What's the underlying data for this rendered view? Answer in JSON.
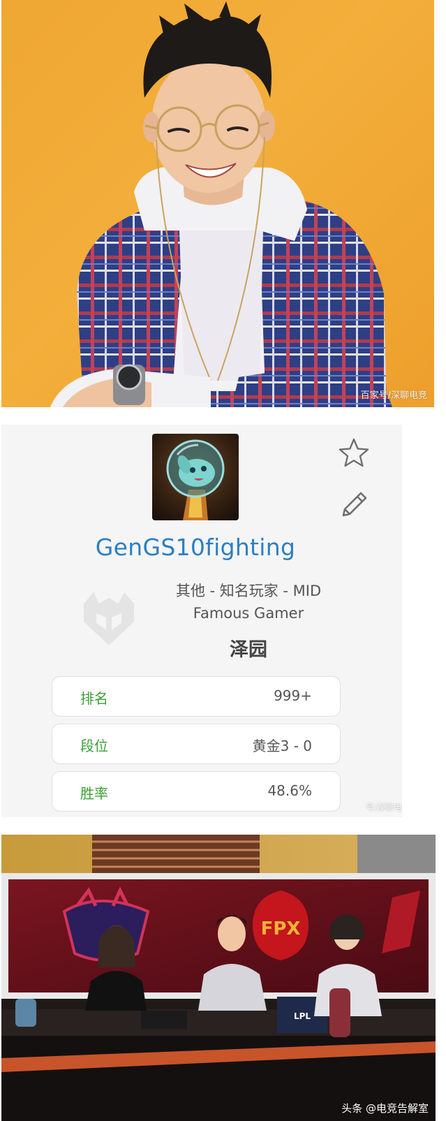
{
  "photo": {
    "watermark": "百家号/深聊电竞"
  },
  "profile": {
    "gamer_id": "GenGS10fighting",
    "region_role": "其他 - 知名玩家 - MID",
    "title": "Famous Gamer",
    "real_name": "泽园",
    "stats": [
      {
        "label": "排名",
        "value": "999+"
      },
      {
        "label": "段位",
        "value": "黄金3 - 0"
      },
      {
        "label": "胜率",
        "value": "48.6%"
      }
    ],
    "watermark": "号/深聊电",
    "colors": {
      "gamer_id": "#2b7fc2",
      "stat_label": "#3aa035",
      "card_bg": "#f5f5f5"
    },
    "icons": {
      "favorite": "star-icon",
      "edit": "pencil-icon",
      "team": "team-logo-icon"
    }
  },
  "studio": {
    "team_logo_text": "FPX",
    "desk_logo_text": "LPL",
    "watermark": "头条 @电竞告解室"
  }
}
